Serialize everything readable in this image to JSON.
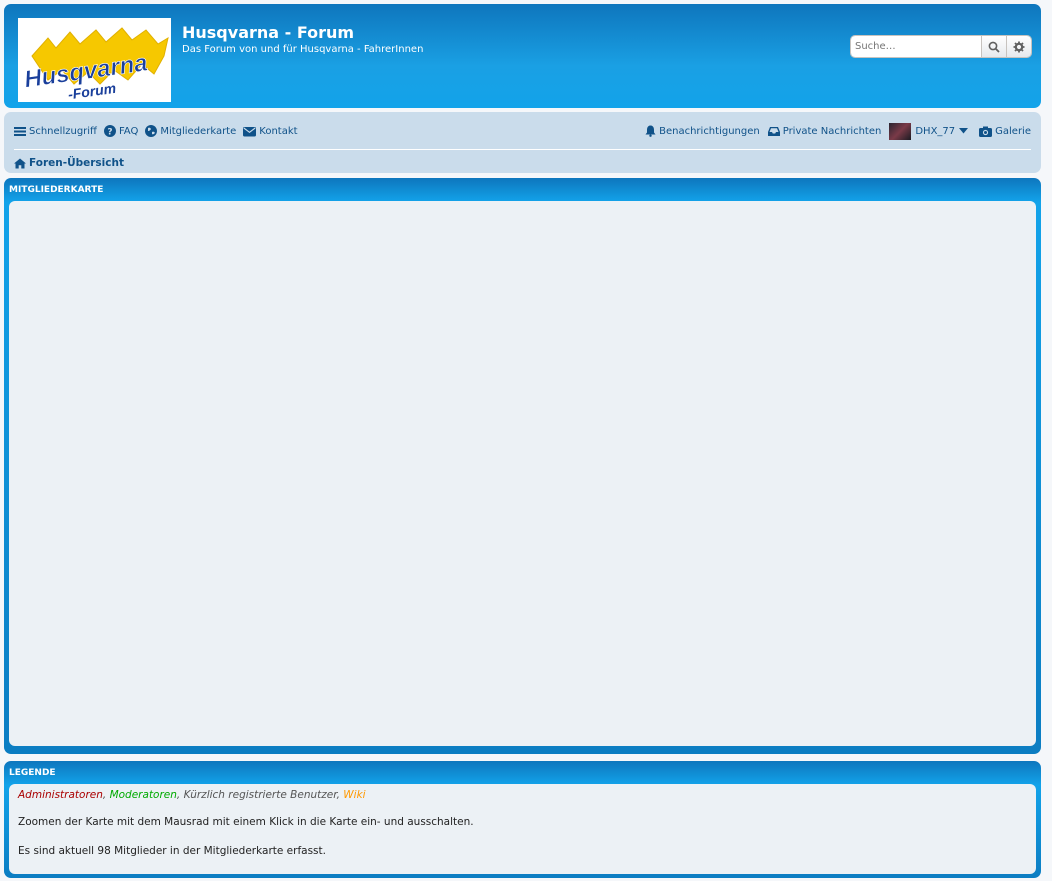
{
  "header": {
    "title": "Husqvarna - Forum",
    "description": "Das Forum von und für Husqvarna - FahrerInnen",
    "logo": {
      "text_main": "Husqvarna",
      "text_sub": "-Forum",
      "colors": {
        "yellow": "#f6c800",
        "blue": "#1a3f9b"
      }
    },
    "search": {
      "placeholder": "Suche…"
    }
  },
  "nav": {
    "left": [
      {
        "label": "Schnellzugriff",
        "icon": "bars-icon"
      },
      {
        "label": "FAQ",
        "icon": "question-circle-icon"
      },
      {
        "label": "Mitgliederkarte",
        "icon": "globe-icon"
      },
      {
        "label": "Kontakt",
        "icon": "envelope-icon"
      }
    ],
    "right": {
      "notifications": "Benachrichtigungen",
      "messages": "Private Nachrichten",
      "user": "DHX_77",
      "gallery": "Galerie"
    },
    "breadcrumb": "Foren-Übersicht"
  },
  "map_panel": {
    "title": "MITGLIEDERKARTE"
  },
  "legend_panel": {
    "title": "LEGENDE",
    "groups": [
      {
        "label": "Administratoren",
        "color": "#aa0000"
      },
      {
        "label": "Moderatoren",
        "color": "#00aa00"
      },
      {
        "label": "Kürzlich registrierte Benutzer",
        "color": "#555555"
      },
      {
        "label": "Wiki",
        "color": "#ff9900"
      }
    ],
    "separator": ", ",
    "zoom_info": "Zoomen der Karte mit dem Mausrad mit einem Klick in die Karte ein- und ausschalten.",
    "count_info": "Es sind aktuell 98 Mitglieder in der Mitgliederkarte erfasst."
  },
  "colors": {
    "link": "#105289",
    "header_blue": "#12a3ea",
    "nav_bg": "#cadceb",
    "panel_bg": "#ecf1f5"
  }
}
